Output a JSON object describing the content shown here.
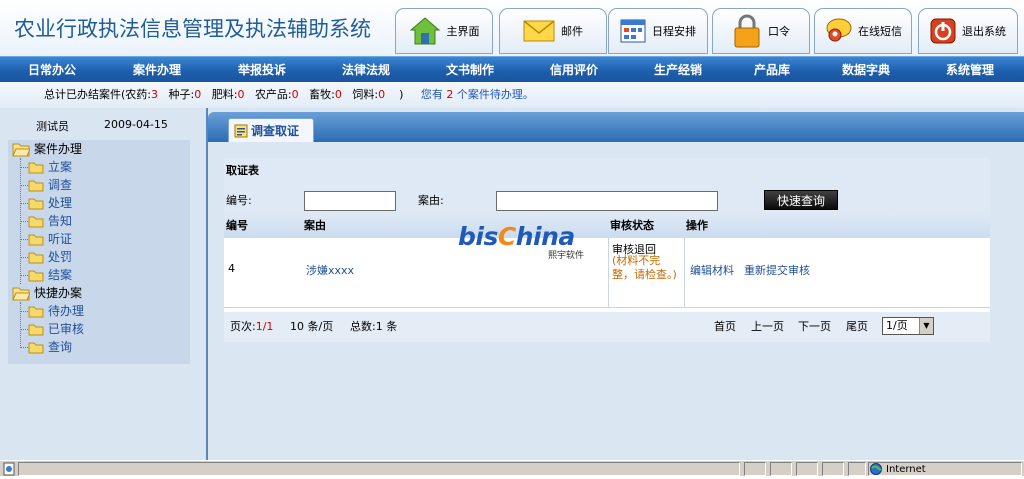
{
  "app": {
    "title": "农业行政执法信息管理及执法辅助系统"
  },
  "toolbar": [
    {
      "label": "主界面",
      "icon": "house-icon"
    },
    {
      "label": "邮件",
      "icon": "envelope-icon"
    },
    {
      "label": "日程安排",
      "icon": "calendar-icon"
    },
    {
      "label": "口令",
      "icon": "padlock-icon"
    },
    {
      "label": "在线短信",
      "icon": "chat-icon"
    },
    {
      "label": "退出系统",
      "icon": "power-icon"
    }
  ],
  "nav": [
    "日常办公",
    "案件办理",
    "举报投诉",
    "法律法规",
    "文书制作",
    "信用评价",
    "生产经销",
    "产品库",
    "数据字典",
    "系统管理"
  ],
  "stats": {
    "prefix": "总计已办结案件(农药:",
    "pesticide": "3",
    "seed_label": "种子:",
    "seed": "0",
    "fert_label": "肥料:",
    "fert": "0",
    "agri_label": "农产品:",
    "agri": "0",
    "livestock_label": "畜牧:",
    "livestock": "0",
    "feed_label": "饲料:",
    "feed": "0",
    "close": ")",
    "pending_pre": "您有",
    "pending_count": "2",
    "pending_post": "个案件待办理。"
  },
  "user": {
    "name": "测试员",
    "date": "2009-04-15"
  },
  "tree": {
    "group1": {
      "label": "案件办理",
      "items": [
        "立案",
        "调查",
        "处理",
        "告知",
        "听证",
        "处罚",
        "结案"
      ]
    },
    "group2": {
      "label": "快捷办案",
      "items": [
        "待办理",
        "已审核",
        "查询"
      ]
    }
  },
  "tab": {
    "label": "调查取证"
  },
  "panel": {
    "title": "取证表",
    "search": {
      "id_label": "编号:",
      "cause_label": "案由:",
      "button": "快速查询",
      "id_value": "",
      "cause_value": ""
    },
    "columns": [
      "编号",
      "案由",
      "审核状态",
      "操作"
    ],
    "rows": [
      {
        "id": "4",
        "cause": "涉嫌xxxx",
        "status": "审核退回",
        "status_note": "(材料不完整，请检查。)",
        "actions": [
          "编辑材料",
          "重新提交审核"
        ]
      }
    ],
    "pager": {
      "page_label": "页次:",
      "page_current": "1",
      "page_total": "/1",
      "per_page": "10 条/页",
      "total": "总数:1 条",
      "links": [
        "首页",
        "上一页",
        "下一页",
        "尾页"
      ],
      "select_value": "1/页"
    }
  },
  "watermark": {
    "brand_a": "bis",
    "brand_b": "C",
    "brand_c": "hina",
    "sub": "熙宇软件"
  },
  "statusbar": {
    "zone": "Internet"
  },
  "colors": {
    "accent": "#1e5fad",
    "title": "#1f5d99",
    "alert": "#d40000"
  }
}
